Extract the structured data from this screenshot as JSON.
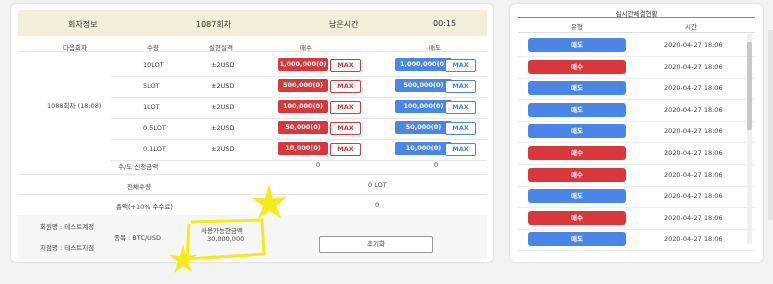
{
  "header": {
    "round_label": "회차정보",
    "round_value": "1087회차",
    "remaining_label": "남은시간",
    "remaining_value": "00:15"
  },
  "table": {
    "columns": [
      "다음회차",
      "수량",
      "실현실격",
      "매수",
      "매도"
    ],
    "next_round": "1088회차 (18:08)",
    "rows": [
      {
        "qty": "10LOT",
        "risk": "±2USD",
        "buy": "1,000,000(0)",
        "sell": "1,000,000(0)"
      },
      {
        "qty": "5LOT",
        "risk": "±2USD",
        "buy": "500,000(0)",
        "sell": "500,000(0)"
      },
      {
        "qty": "1LOT",
        "risk": "±2USD",
        "buy": "100,000(0)",
        "sell": "100,000(0)"
      },
      {
        "qty": "0.5LOT",
        "risk": "±2USD",
        "buy": "50,000(0)",
        "sell": "50,000(0)"
      },
      {
        "qty": "0.1LOT",
        "risk": "±2USD",
        "buy": "10,000(0)",
        "sell": "10,000(0)"
      }
    ],
    "max_label": "MAX"
  },
  "summary": {
    "fee_label": "수/도 신청금액",
    "fee_buy": "0",
    "fee_sell": "0",
    "total_qty_label": "전체수량",
    "total_qty": "0 LOT",
    "total_label": "총액(+10% 수수료)",
    "total": "0"
  },
  "footer": {
    "member": "회원명 : 테스트계정",
    "branch": "지점명 : 테스트지점",
    "item": "종목 : BTC/USD",
    "available_label": "사용가능한금액",
    "available": "30,000,000",
    "reset": "초기화"
  },
  "realtime": {
    "title": "실시간체결현황",
    "col_type": "유형",
    "col_time": "시간",
    "rows": [
      {
        "type": "매도",
        "kind": "sell",
        "time": "2020-04-27 18:06"
      },
      {
        "type": "매수",
        "kind": "buy",
        "time": "2020-04-27 18:06"
      },
      {
        "type": "매도",
        "kind": "sell",
        "time": "2020-04-27 18:06"
      },
      {
        "type": "매도",
        "kind": "sell",
        "time": "2020-04-27 18:06"
      },
      {
        "type": "매도",
        "kind": "sell",
        "time": "2020-04-27 18:06"
      },
      {
        "type": "매수",
        "kind": "buy",
        "time": "2020-04-27 18:06"
      },
      {
        "type": "매수",
        "kind": "buy",
        "time": "2020-04-27 18:06"
      },
      {
        "type": "매도",
        "kind": "sell",
        "time": "2020-04-27 18:06"
      },
      {
        "type": "매수",
        "kind": "buy",
        "time": "2020-04-27 18:06"
      },
      {
        "type": "매도",
        "kind": "sell",
        "time": "2020-04-27 18:06"
      }
    ]
  },
  "colors": {
    "buy": "#d9373c",
    "sell": "#4a86e8",
    "header_bg": "#f1efd9",
    "highlight": "#f6ea1a"
  }
}
